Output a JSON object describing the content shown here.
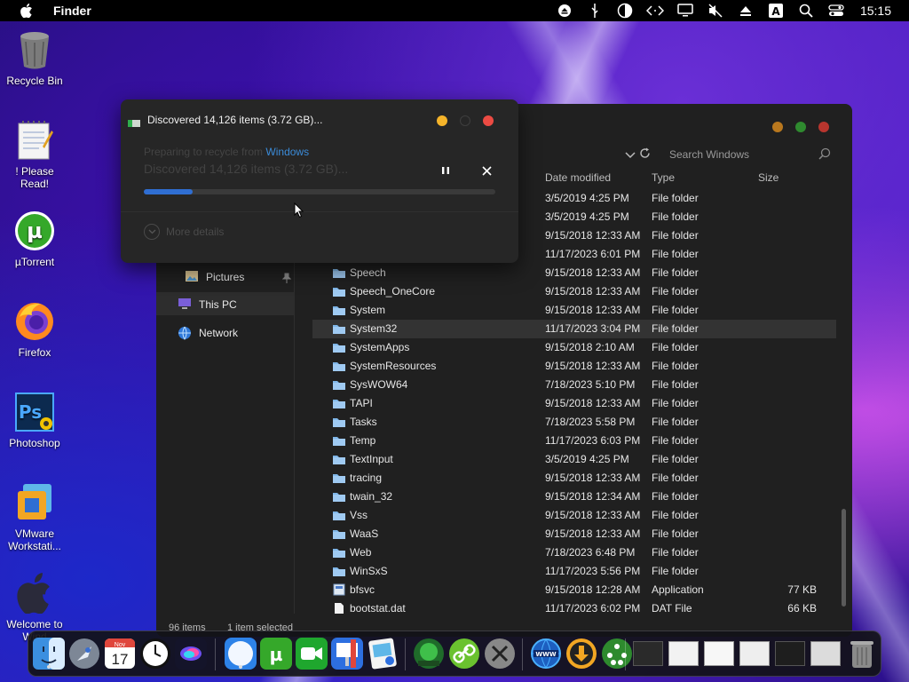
{
  "menubar": {
    "app_name": "Finder",
    "clock": "15:15",
    "status_icons": [
      "eject-icon",
      "usb-icon",
      "half-circle-icon",
      "code-arrows-icon",
      "display-icon",
      "mute-icon",
      "upload-icon",
      "keyboard-a-icon",
      "search-icon",
      "control-center-icon"
    ]
  },
  "desktop": {
    "icons": [
      {
        "label": "Recycle Bin",
        "icon": "recycle-bin-icon"
      },
      {
        "label": "! Please Read!",
        "icon": "notepad-icon"
      },
      {
        "label": "µTorrent",
        "icon": "utorrent-icon"
      },
      {
        "label": "Firefox",
        "icon": "firefox-icon"
      },
      {
        "label": "Photoshop",
        "icon": "photoshop-icon"
      },
      {
        "label": "VMware Workstati...",
        "icon": "vmware-icon"
      },
      {
        "label": "Welcome to Wind",
        "icon": "apple-logo-icon"
      }
    ]
  },
  "explorer": {
    "search_placeholder": "Search Windows",
    "columns": {
      "date": "Date modified",
      "type": "Type",
      "size": "Size"
    },
    "nav": {
      "pictures": "Pictures",
      "this_pc": "This PC",
      "network": "Network"
    },
    "rows": [
      {
        "name": "",
        "date": "3/5/2019 4:25 PM",
        "type": "File folder",
        "size": "",
        "kind": "folder"
      },
      {
        "name": "",
        "date": "3/5/2019 4:25 PM",
        "type": "File folder",
        "size": "",
        "kind": "folder"
      },
      {
        "name": "",
        "date": "9/15/2018 12:33 AM",
        "type": "File folder",
        "size": "",
        "kind": "folder"
      },
      {
        "name": "",
        "date": "11/17/2023 6:01 PM",
        "type": "File folder",
        "size": "",
        "kind": "folder"
      },
      {
        "name": "Speech",
        "date": "9/15/2018 12:33 AM",
        "type": "File folder",
        "size": "",
        "kind": "folder"
      },
      {
        "name": "Speech_OneCore",
        "date": "9/15/2018 12:33 AM",
        "type": "File folder",
        "size": "",
        "kind": "folder"
      },
      {
        "name": "System",
        "date": "9/15/2018 12:33 AM",
        "type": "File folder",
        "size": "",
        "kind": "folder"
      },
      {
        "name": "System32",
        "date": "11/17/2023 3:04 PM",
        "type": "File folder",
        "size": "",
        "kind": "folder",
        "selected": true
      },
      {
        "name": "SystemApps",
        "date": "9/15/2018 2:10 AM",
        "type": "File folder",
        "size": "",
        "kind": "folder"
      },
      {
        "name": "SystemResources",
        "date": "9/15/2018 12:33 AM",
        "type": "File folder",
        "size": "",
        "kind": "folder"
      },
      {
        "name": "SysWOW64",
        "date": "7/18/2023 5:10 PM",
        "type": "File folder",
        "size": "",
        "kind": "folder"
      },
      {
        "name": "TAPI",
        "date": "9/15/2018 12:33 AM",
        "type": "File folder",
        "size": "",
        "kind": "folder"
      },
      {
        "name": "Tasks",
        "date": "7/18/2023 5:58 PM",
        "type": "File folder",
        "size": "",
        "kind": "folder"
      },
      {
        "name": "Temp",
        "date": "11/17/2023 6:03 PM",
        "type": "File folder",
        "size": "",
        "kind": "folder"
      },
      {
        "name": "TextInput",
        "date": "3/5/2019 4:25 PM",
        "type": "File folder",
        "size": "",
        "kind": "folder"
      },
      {
        "name": "tracing",
        "date": "9/15/2018 12:33 AM",
        "type": "File folder",
        "size": "",
        "kind": "folder"
      },
      {
        "name": "twain_32",
        "date": "9/15/2018 12:34 AM",
        "type": "File folder",
        "size": "",
        "kind": "folder"
      },
      {
        "name": "Vss",
        "date": "9/15/2018 12:33 AM",
        "type": "File folder",
        "size": "",
        "kind": "folder"
      },
      {
        "name": "WaaS",
        "date": "9/15/2018 12:33 AM",
        "type": "File folder",
        "size": "",
        "kind": "folder"
      },
      {
        "name": "Web",
        "date": "7/18/2023 6:48 PM",
        "type": "File folder",
        "size": "",
        "kind": "folder"
      },
      {
        "name": "WinSxS",
        "date": "11/17/2023 5:56 PM",
        "type": "File folder",
        "size": "",
        "kind": "folder"
      },
      {
        "name": "bfsvc",
        "date": "9/15/2018 12:28 AM",
        "type": "Application",
        "size": "77 KB",
        "kind": "app"
      },
      {
        "name": "bootstat.dat",
        "date": "11/17/2023 6:02 PM",
        "type": "DAT File",
        "size": "66 KB",
        "kind": "file"
      }
    ],
    "status": {
      "count": "96 items",
      "selected": "1 item selected"
    }
  },
  "dialog": {
    "title": "Discovered 14,126 items (3.72 GB)...",
    "prep_prefix": "Preparing to recycle from",
    "prep_link": "Windows",
    "big_status": "Discovered 14,126 items (3.72 GB)...",
    "progress": 0.14,
    "more_details": "More details"
  },
  "dock": {
    "calendar_month": "Nov",
    "calendar_day": "17",
    "items": [
      "finder-icon",
      "launchpad-icon",
      "calendar-icon",
      "clock-icon",
      "siri-icon",
      "safari-icon",
      "utorrent-icon",
      "facetime-icon",
      "keynote-icon",
      "preview-icon",
      "collabsysos-icon",
      "link-icon",
      "utilities-icon",
      "www-icon",
      "download-icon",
      "network-icon"
    ]
  },
  "colors": {
    "accent": "#2f6ed2",
    "link": "#3b8bd8",
    "folder": "#7fb6e8"
  }
}
